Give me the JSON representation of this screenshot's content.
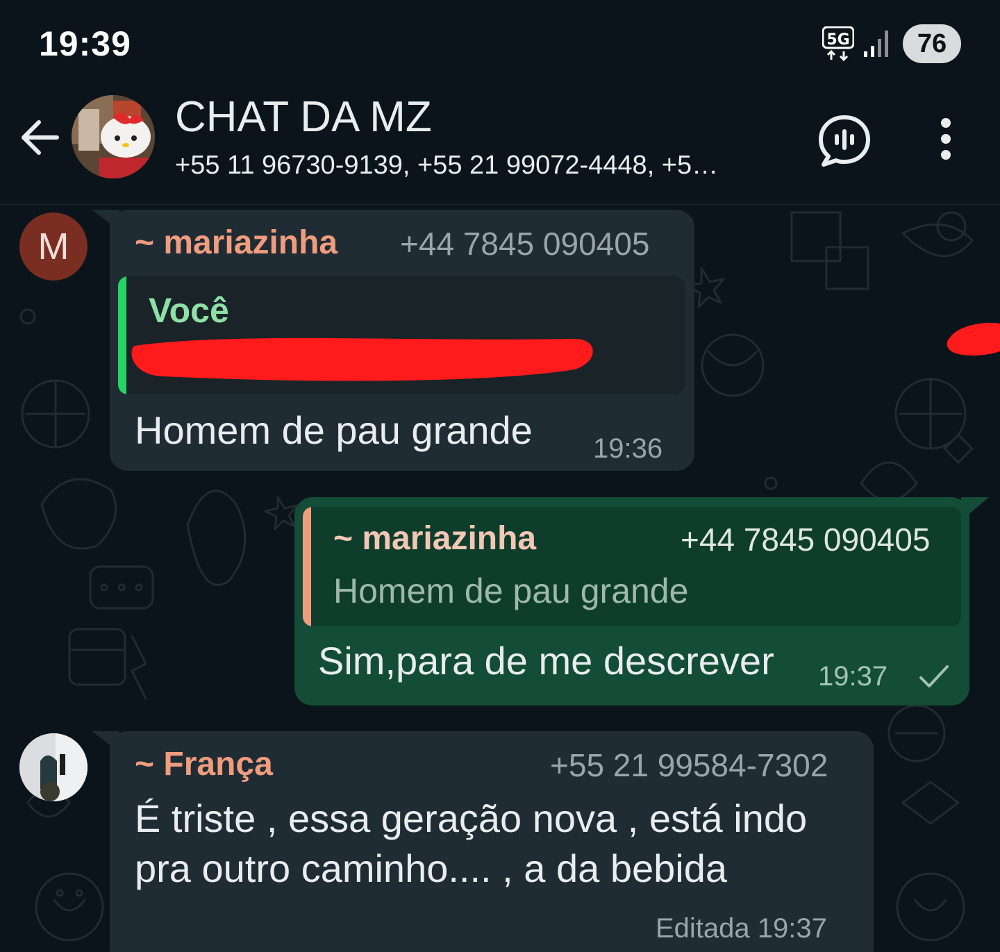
{
  "status_bar": {
    "time": "19:39",
    "network": "5G",
    "battery": "76"
  },
  "header": {
    "title": "CHAT DA MZ",
    "members": "+55 11 96730-9139, +55 21 99072-4448, +5…"
  },
  "messages": [
    {
      "avatar_letter": "M",
      "sender": "~ mariazinha",
      "phone": "+44 7845 090405",
      "quote_author": "Você",
      "text": "Homem de pau grande",
      "time": "19:36"
    },
    {
      "quote_sender": "~ mariazinha",
      "quote_phone": "+44 7845 090405",
      "quote_text": "Homem de pau grande",
      "text": "Sim,para de me descrever",
      "time": "19:37"
    },
    {
      "sender": "~ França",
      "phone": "+55 21 99584-7302",
      "text_line1": "É triste , essa geração nova , está indo",
      "text_line2": "pra outro caminho.... , a da bebida",
      "time": "Editada 19:37"
    }
  ],
  "colors": {
    "background": "#0b141a",
    "incoming_bubble": "#202c33",
    "outgoing_bubble": "#144d37",
    "sender_name": "#f09c7e",
    "quote_accent_self": "#25d366",
    "quote_accent_other": "#f09c7e",
    "redaction": "#ff1b1b"
  },
  "icons": [
    "back-arrow-icon",
    "voice-chat-icon",
    "more-vert-icon",
    "signal-icon",
    "read-check-icon"
  ]
}
